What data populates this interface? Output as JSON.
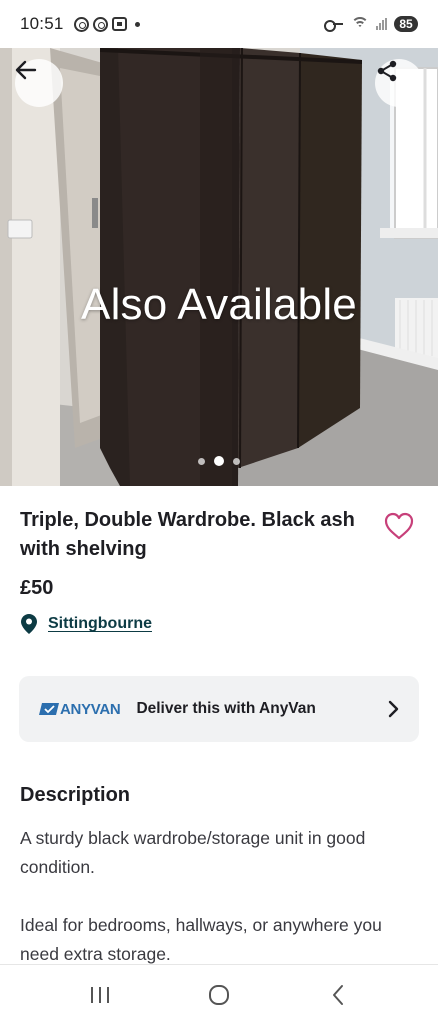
{
  "status_bar": {
    "time": "10:51",
    "battery": "85",
    "icons": [
      "camera-ring-icon",
      "camera-ring-icon",
      "screenshot-icon",
      "notification-dot-icon",
      "vpn-key-icon",
      "wifi-icon",
      "signal-icon",
      "battery-icon"
    ]
  },
  "hero": {
    "overlay_text": "Also Available",
    "image_subject": "black ash wardrobe",
    "carousel_count": 3,
    "carousel_active_index": 1,
    "back_icon": "arrow-left-icon",
    "share_icon": "share-icon"
  },
  "listing": {
    "title": "Triple, Double Wardrobe. Black ash with shelving",
    "price": "£50",
    "location": "Sittingbourne",
    "favourite_icon": "heart-outline-icon"
  },
  "delivery": {
    "logo_text": "ANYVAN",
    "label": "Deliver this with AnyVan",
    "chevron_icon": "chevron-right-icon"
  },
  "description": {
    "heading": "Description",
    "paragraphs": [
      "A sturdy black wardrobe/storage unit in good condition.",
      "Ideal for bedrooms, hallways, or anywhere you need extra storage."
    ]
  },
  "nav_bar": {
    "buttons": [
      "recent-apps-icon",
      "home-icon",
      "back-icon"
    ]
  },
  "colors": {
    "text_primary": "#1e1e23",
    "location_link": "#0d3b44",
    "heart": "#c7407a",
    "anyvan_blue": "#2c6fae",
    "card_bg": "#f1f2f3"
  }
}
